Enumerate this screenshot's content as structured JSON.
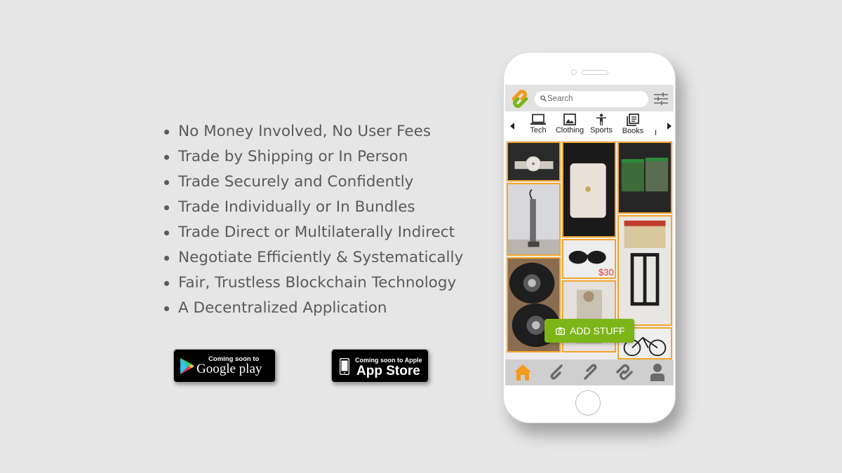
{
  "features": [
    "No Money Involved, No User Fees",
    "Trade by Shipping or In Person",
    "Trade Securely and Confidently",
    "Trade Individually or In Bundles",
    "Trade Direct or Multilaterally Indirect",
    "Negotiate Efficiently & Systematically",
    "Fair, Trustless Blockchain Technology",
    "A Decentralized Application"
  ],
  "badges": {
    "google": {
      "small": "Coming soon to",
      "big": "Google play"
    },
    "apple": {
      "small": "Coming soon to Apple",
      "big": "App Store"
    }
  },
  "app": {
    "search_placeholder": "Search",
    "categories": [
      "Tech",
      "Clothing",
      "Sports",
      "Books"
    ],
    "more_category_glyph": "I",
    "add_button_label": "ADD STUFF",
    "price_tag": "$30",
    "colors": {
      "accent_orange": "#f4a52c",
      "accent_green": "#7cb518",
      "nav_active": "#f39a1e"
    },
    "nav_items": [
      "home-icon",
      "link-single-icon",
      "link-diagonal-icon",
      "link-double-icon",
      "profile-icon"
    ]
  }
}
